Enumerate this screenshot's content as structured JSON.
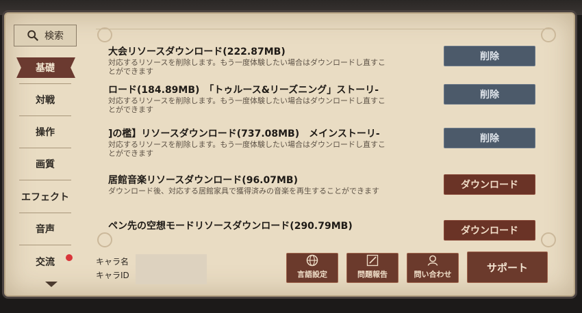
{
  "sidebar": {
    "search_label": "検索",
    "items": [
      {
        "label": "基礎",
        "active": true
      },
      {
        "label": "対戦"
      },
      {
        "label": "操作"
      },
      {
        "label": "画質"
      },
      {
        "label": "エフェクト"
      },
      {
        "label": "音声"
      },
      {
        "label": "交流",
        "notification": true
      }
    ]
  },
  "resources": [
    {
      "title": "大会リソースダウンロード(222.87MB)",
      "desc": "対応するリソースを削除します。もう一度体験したい場合はダウンロードし直すことができます",
      "button": "削除",
      "type": "delete"
    },
    {
      "title": "ロード(184.89MB)　「トゥルース&リーズニング」ストーリ-",
      "desc": "対応するリソースを削除します。もう一度体験したい場合はダウンロードし直すことができます",
      "button": "削除",
      "type": "delete"
    },
    {
      "title": "]の檻】リソースダウンロード(737.08MB)　メインストーリ-",
      "desc": "対応するリソースを削除します。もう一度体験したい場合はダウンロードし直すことができます",
      "button": "削除",
      "type": "delete"
    },
    {
      "title": "居館音楽リソースダウンロード(96.07MB)",
      "desc": "ダウンロード後、対応する居館家具で獲得済みの音楽を再生することができます",
      "button": "ダウンロード",
      "type": "download"
    },
    {
      "title": "ペン先の空想モードリソースダウンロード(290.79MB)",
      "desc": "",
      "button": "ダウンロード",
      "type": "download"
    }
  ],
  "footer": {
    "char_name_label": "キャラ名",
    "char_id_label": "キャラID",
    "language_label": "言語設定",
    "report_label": "問題報告",
    "contact_label": "問い合わせ",
    "support_label": "サポート"
  },
  "colors": {
    "delete_button": "#4c5a6a",
    "download_button": "#6a3326",
    "panel": "#e9dcc3",
    "active_tab": "#6b3a30",
    "notification": "#d9353a"
  }
}
